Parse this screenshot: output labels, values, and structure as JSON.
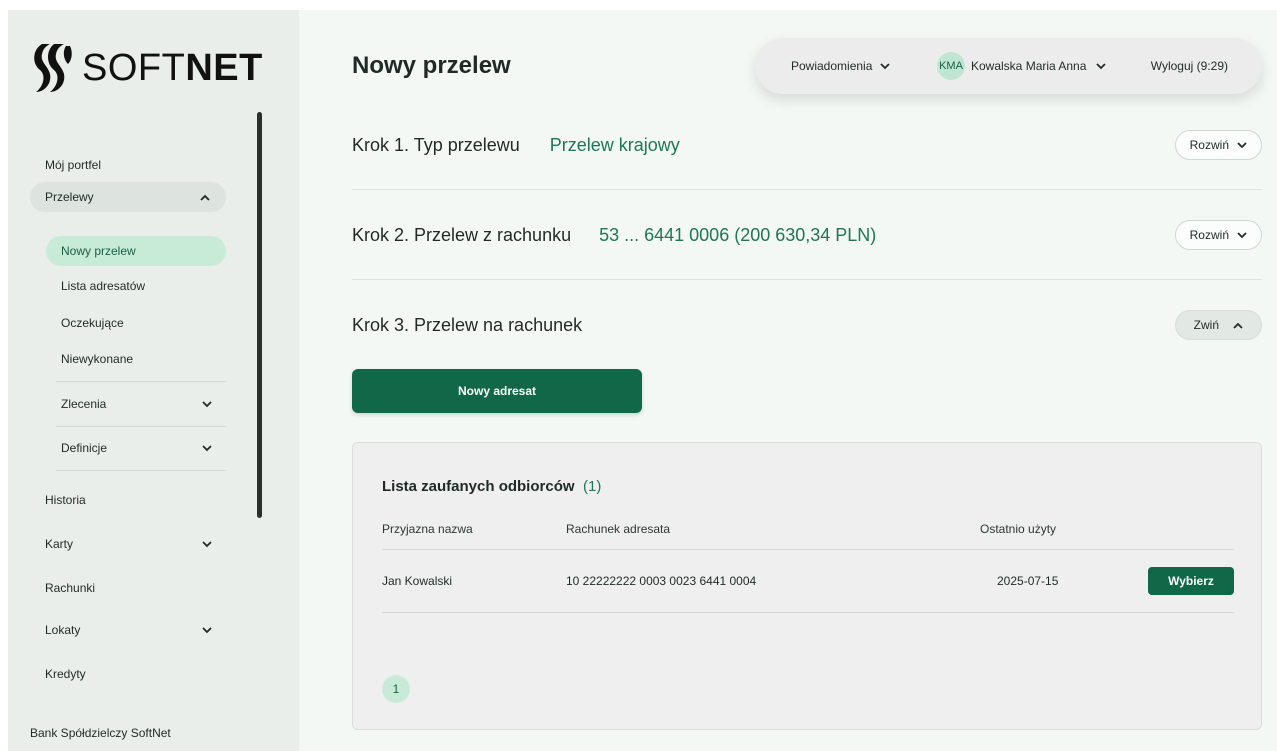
{
  "brand": {
    "logo_text_light": "SOFT",
    "logo_text_bold": "NET",
    "footer": "Bank Spółdzielczy SoftNet",
    "accent": "#116848",
    "accent_light": "#c8ebd8"
  },
  "sidebar": {
    "my_portfolio": "Mój portfel",
    "transfers": {
      "label": "Przelewy",
      "items": [
        {
          "label": "Nowy przelew",
          "active": true
        },
        {
          "label": "Lista adresatów"
        },
        {
          "label": "Oczekujące"
        },
        {
          "label": "Niewykonane"
        }
      ],
      "groups": [
        {
          "label": "Zlecenia"
        },
        {
          "label": "Definicje"
        }
      ]
    },
    "history": "Historia",
    "cards": "Karty",
    "accounts": "Rachunki",
    "deposits": "Lokaty",
    "loans": "Kredyty"
  },
  "header": {
    "title": "Nowy przelew",
    "notifications": "Powiadomienia",
    "user_initials": "KMA",
    "user_name": "Kowalska Maria Anna",
    "logout": "Wyloguj (9:29)"
  },
  "steps": [
    {
      "label": "Krok 1. Typ przelewu",
      "value": "Przelew krajowy",
      "button": "Rozwiń"
    },
    {
      "label": "Krok 2. Przelew z rachunku",
      "value": "53 ... 6441 0006 (200 630,34 PLN)",
      "button": "Rozwiń"
    },
    {
      "label": "Krok 3. Przelew na rachunek",
      "value": "",
      "button": "Zwiń"
    }
  ],
  "new_recipient_button": "Nowy adresat",
  "trusted": {
    "title": "Lista zaufanych odbiorców",
    "count": "(1)",
    "columns": [
      "Przyjazna nazwa",
      "Rachunek adresata",
      "Ostatnio użyty"
    ],
    "rows": [
      {
        "name": "Jan Kowalski",
        "account": "10 22222222 0003 0023 6441 0004",
        "last_used": "2025-07-15",
        "action": "Wybierz"
      }
    ],
    "page": "1"
  }
}
